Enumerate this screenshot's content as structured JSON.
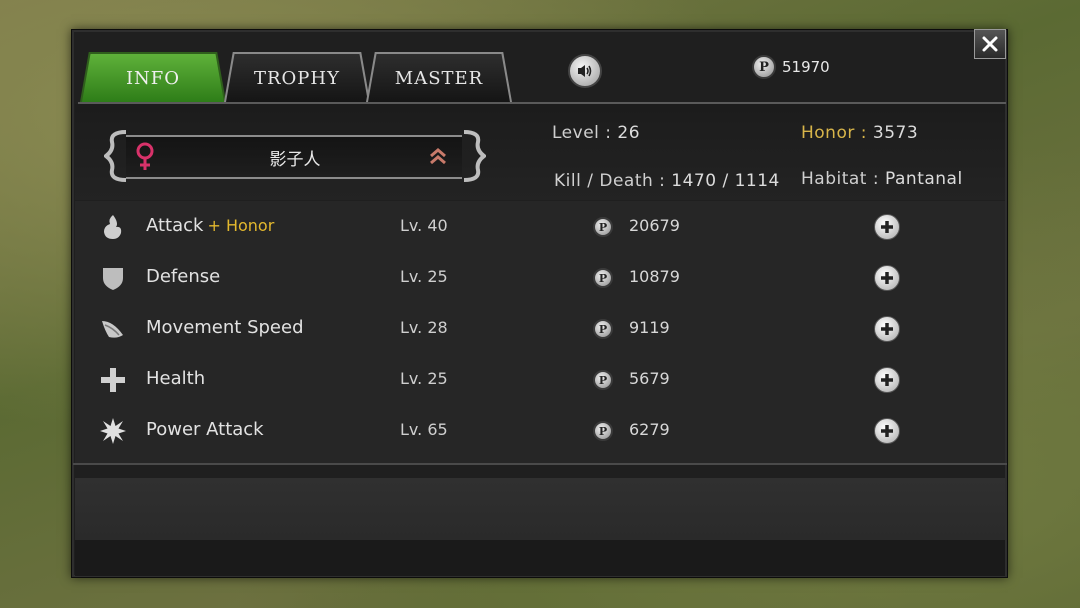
{
  "tabs": [
    {
      "label": "INFO",
      "active": true
    },
    {
      "label": "TROPHY",
      "active": false
    },
    {
      "label": "MASTER",
      "active": false
    }
  ],
  "currency": {
    "symbol": "P",
    "amount": "51970"
  },
  "character": {
    "name": "影子人",
    "gender_icon": "female-symbol-icon",
    "rank_icon": "rank-chevron-icon"
  },
  "stats": {
    "level_label": "Level :",
    "level_value": "26",
    "honor_label": "Honor :",
    "honor_value": "3573",
    "kd_label": "Kill / Death :",
    "kd_value": "1470 / 1114",
    "habitat_label": "Habitat :",
    "habitat_value": "Pantanal"
  },
  "upgrades": [
    {
      "name": "Attack",
      "extra": "+ Honor",
      "level": "Lv. 40",
      "price": "20679",
      "icon": "flame-icon"
    },
    {
      "name": "Defense",
      "extra": "",
      "level": "Lv. 25",
      "price": "10879",
      "icon": "shield-icon"
    },
    {
      "name": "Movement Speed",
      "extra": "",
      "level": "Lv. 28",
      "price": "9119",
      "icon": "wing-icon"
    },
    {
      "name": "Health",
      "extra": "",
      "level": "Lv. 25",
      "price": "5679",
      "icon": "cross-icon"
    },
    {
      "name": "Power Attack",
      "extra": "",
      "level": "Lv. 65",
      "price": "6279",
      "icon": "burst-icon"
    }
  ],
  "colors": {
    "active_tab": "#3f9a26",
    "honor_gold": "#d8b54a",
    "gender_pink": "#d8326a"
  }
}
